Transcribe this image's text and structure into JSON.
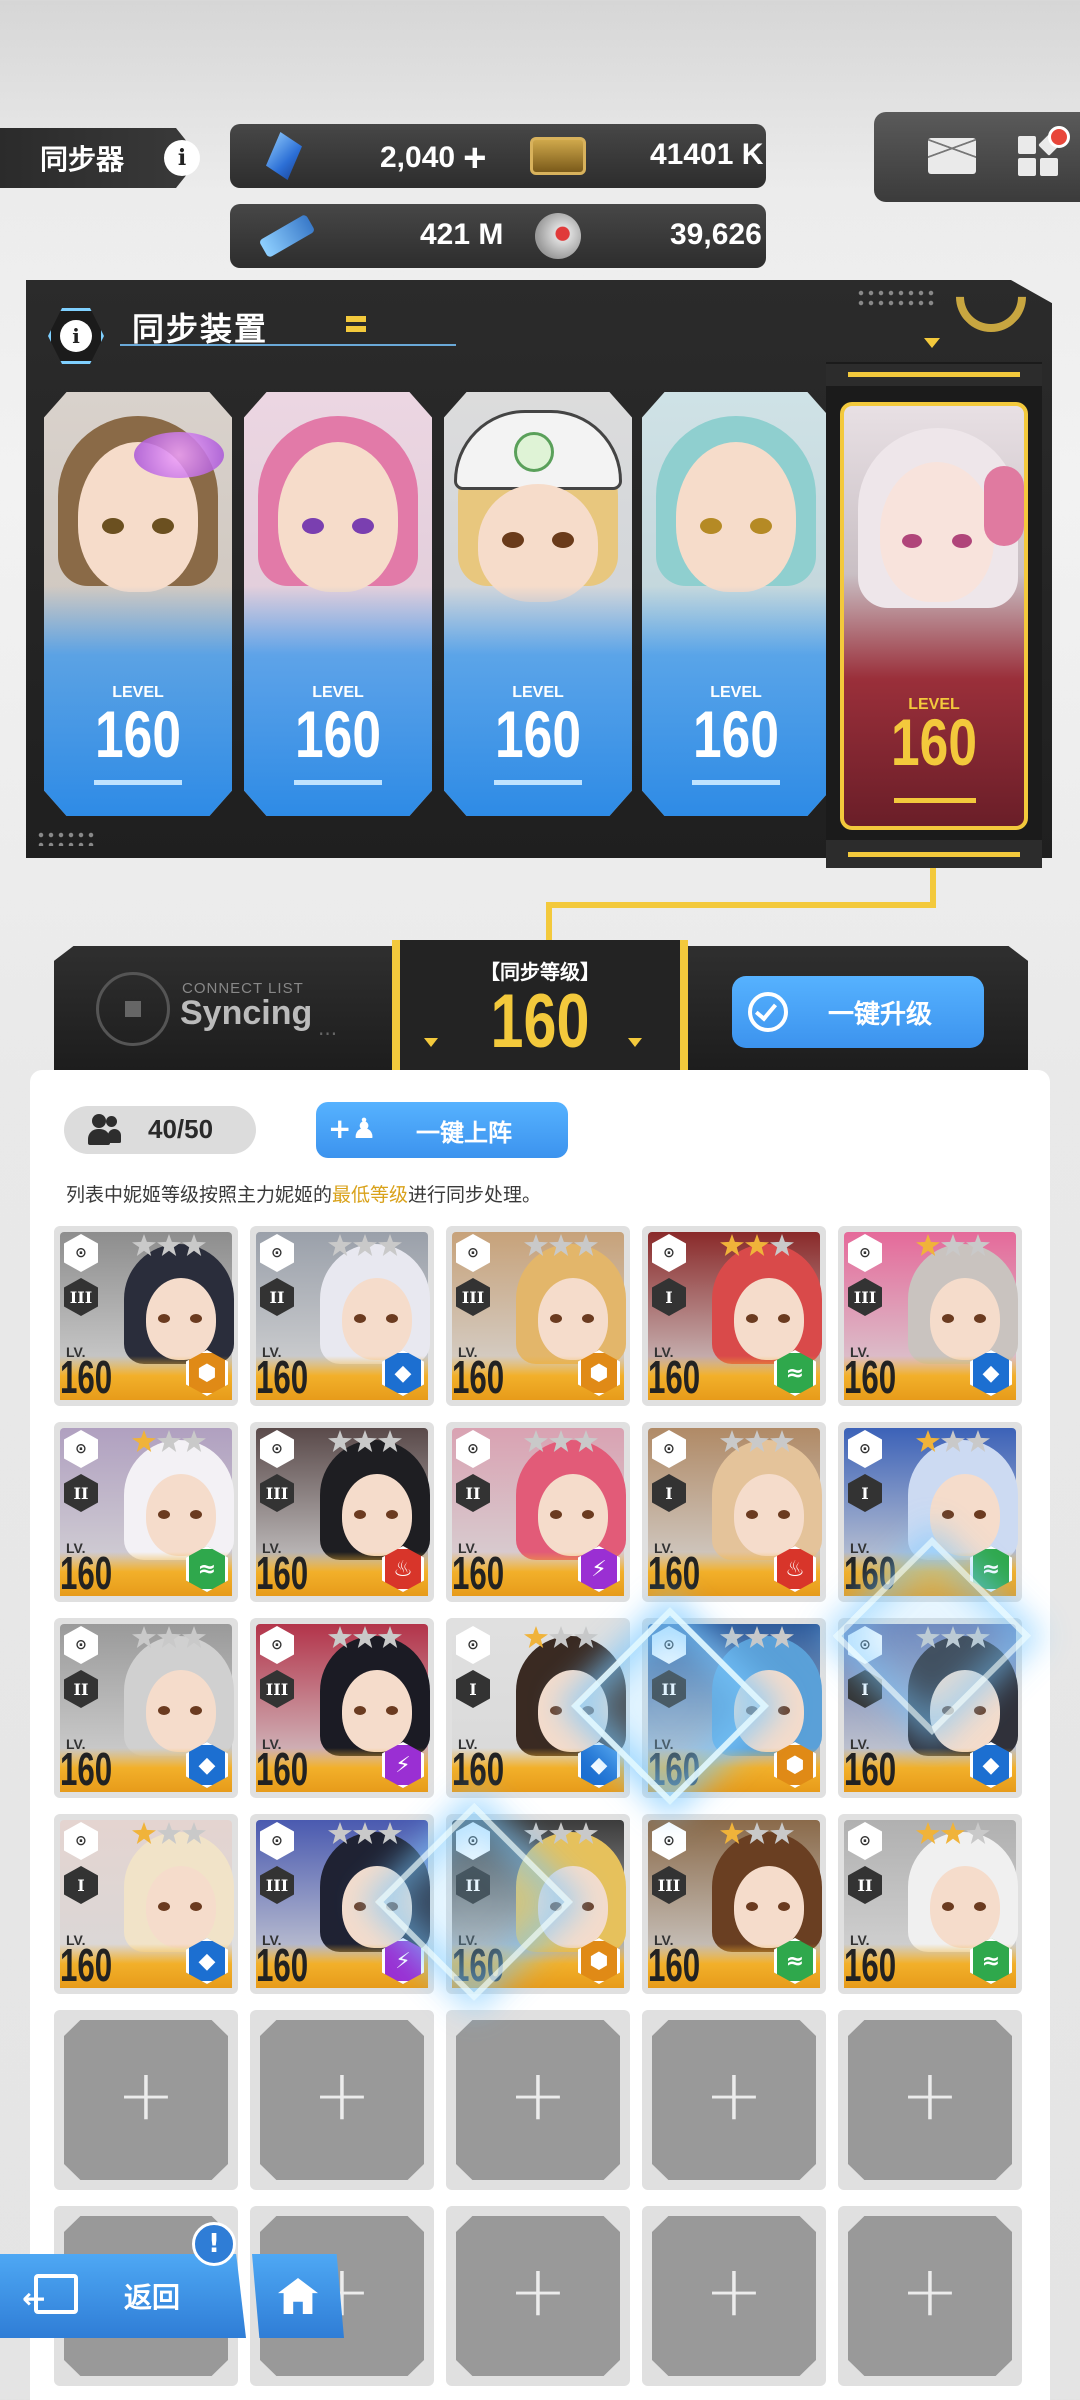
{
  "header": {
    "title": "同步器",
    "resources": {
      "gems": "2,040",
      "credits": "41401 K",
      "chips": "421 M",
      "cores": "39,626"
    }
  },
  "sync_device": {
    "title": "同步装置",
    "level_word": "LEVEL",
    "main_units": [
      {
        "level": "160"
      },
      {
        "level": "160"
      },
      {
        "level": "160"
      },
      {
        "level": "160"
      },
      {
        "level": "160"
      }
    ]
  },
  "sync_bar": {
    "connect_list": "CONNECT LIST",
    "status": "Syncing",
    "status_dots": "...",
    "level_label": "【同步等级】",
    "level": "160",
    "upgrade_button": "一键升级"
  },
  "roster": {
    "count": "40/50",
    "deploy_button": "一键上阵",
    "hint_prefix": "列表中妮姬等级按照主力妮姬的",
    "hint_emphasis": "最低等级",
    "hint_suffix": "进行同步处理。",
    "lv_label": "LV.",
    "characters": [
      {
        "level": "160",
        "rank": "III",
        "stars": 0,
        "element": "iron",
        "element_color": "#e08a16"
      },
      {
        "level": "160",
        "rank": "II",
        "stars": 0,
        "element": "water",
        "element_color": "#1c6fd1"
      },
      {
        "level": "160",
        "rank": "III",
        "stars": 0,
        "element": "iron",
        "element_color": "#e08a16"
      },
      {
        "level": "160",
        "rank": "I",
        "stars": 2,
        "element": "wind",
        "element_color": "#2fa84c"
      },
      {
        "level": "160",
        "rank": "III",
        "stars": 1,
        "element": "water",
        "element_color": "#1c6fd1"
      },
      {
        "level": "160",
        "rank": "II",
        "stars": 1,
        "element": "wind",
        "element_color": "#2fa84c"
      },
      {
        "level": "160",
        "rank": "III",
        "stars": 0,
        "element": "fire",
        "element_color": "#d8352a"
      },
      {
        "level": "160",
        "rank": "II",
        "stars": 0,
        "element": "electric",
        "element_color": "#9a2fd3"
      },
      {
        "level": "160",
        "rank": "I",
        "stars": 0,
        "element": "fire",
        "element_color": "#d8352a"
      },
      {
        "level": "160",
        "rank": "I",
        "stars": 1,
        "element": "wind",
        "element_color": "#2fa84c"
      },
      {
        "level": "160",
        "rank": "II",
        "stars": 0,
        "element": "water",
        "element_color": "#1c6fd1"
      },
      {
        "level": "160",
        "rank": "III",
        "stars": 0,
        "element": "electric",
        "element_color": "#9a2fd3"
      },
      {
        "level": "160",
        "rank": "I",
        "stars": 1,
        "element": "water",
        "element_color": "#1c6fd1"
      },
      {
        "level": "160",
        "rank": "II",
        "stars": 0,
        "element": "iron",
        "element_color": "#e08a16"
      },
      {
        "level": "160",
        "rank": "I",
        "stars": 0,
        "element": "water",
        "element_color": "#1c6fd1"
      },
      {
        "level": "160",
        "rank": "I",
        "stars": 1,
        "element": "water",
        "element_color": "#1c6fd1"
      },
      {
        "level": "160",
        "rank": "III",
        "stars": 0,
        "element": "electric",
        "element_color": "#9a2fd3"
      },
      {
        "level": "160",
        "rank": "II",
        "stars": 0,
        "element": "iron",
        "element_color": "#e08a16"
      },
      {
        "level": "160",
        "rank": "III",
        "stars": 1,
        "element": "wind",
        "element_color": "#2fa84c"
      },
      {
        "level": "160",
        "rank": "II",
        "stars": 2,
        "element": "wind",
        "element_color": "#2fa84c"
      }
    ],
    "empty_slots": 10
  },
  "bottom_nav": {
    "back": "返回",
    "alert": "!"
  },
  "colors": {
    "accent_blue": "#3c93ee",
    "accent_gold": "#f3c93c",
    "panel_dark": "#232323"
  }
}
